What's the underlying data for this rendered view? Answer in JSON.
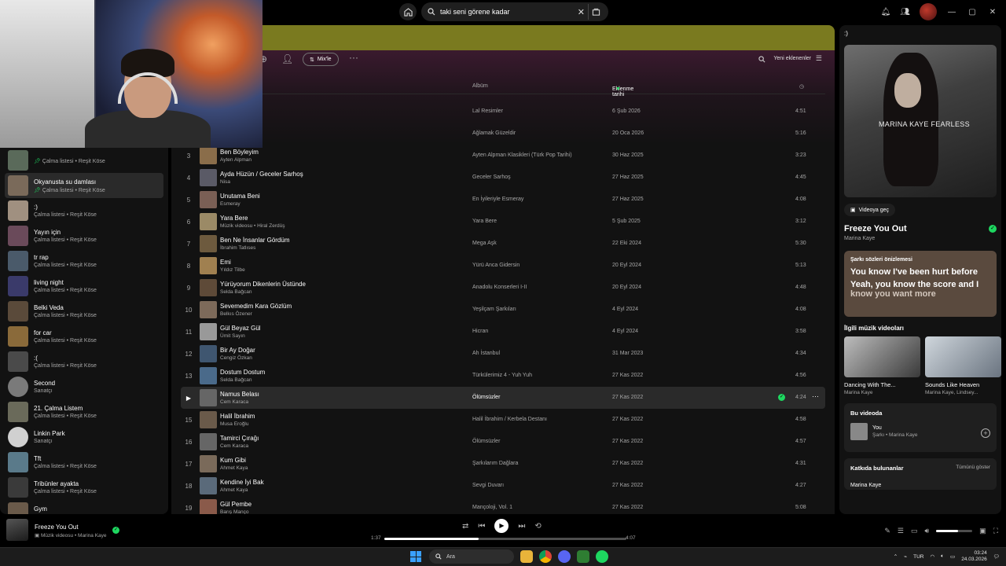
{
  "topbar": {
    "search_value": "taki seni görene kadar",
    "controls": [
      "—",
      "▢",
      "✕"
    ]
  },
  "banner_color": "#7a7a1f",
  "accent_color": "#1ed760",
  "action_bar": {
    "mix_label": "Mix'le",
    "sort_label": "Yeni eklenenler"
  },
  "columns": {
    "album": "Albüm",
    "date": "Eklenme tarihi"
  },
  "tracks": [
    {
      "num": "",
      "title": "",
      "artist": "",
      "album": "Lal Resimler",
      "date": "6 Şub 2026",
      "duration": "4:51",
      "color": "#6b4e3c"
    },
    {
      "num": "",
      "title": "",
      "artist": "",
      "album": "Ağlamak Güzeldir",
      "date": "20 Oca 2026",
      "duration": "5:16",
      "color": "#444"
    },
    {
      "num": "3",
      "title": "Ben Böyleyim",
      "artist": "Ayten Alpman",
      "album": "Ayten Alpman Klasikleri (Türk Pop Tarihi)",
      "date": "30 Haz 2025",
      "duration": "3:23",
      "color": "#8a6d4a"
    },
    {
      "num": "4",
      "title": "Ayda Hüzün / Geceler Sarhoş",
      "artist": "Nisa",
      "album": "Geceler Sarhoş",
      "date": "27 Haz 2025",
      "duration": "4:45",
      "color": "#5a5a66"
    },
    {
      "num": "5",
      "title": "Unutama Beni",
      "artist": "Esmeray",
      "album": "En İyileriyle Esmeray",
      "date": "27 Haz 2025",
      "duration": "4:08",
      "color": "#7a5f55"
    },
    {
      "num": "6",
      "title": "Yara Bere",
      "artist": "Müzik videosu • Hiral Zerdüş",
      "album": "Yara Bere",
      "date": "5 Şub 2025",
      "duration": "3:12",
      "color": "#9b8a66"
    },
    {
      "num": "7",
      "title": "Ben Ne İnsanlar Gördüm",
      "artist": "İbrahim Tatlıses",
      "album": "Mega Aşk",
      "date": "22 Eki 2024",
      "duration": "5:30",
      "color": "#6d5a3e"
    },
    {
      "num": "8",
      "title": "Emi",
      "artist": "Yıldız Tilbe",
      "album": "Yürü Anca Gidersin",
      "date": "20 Eyl 2024",
      "duration": "5:13",
      "color": "#a08050"
    },
    {
      "num": "9",
      "title": "Yürüyorum Dikenlerin Üstünde",
      "artist": "Selda Bağcan",
      "album": "Anadolu Konserleri I-II",
      "date": "20 Eyl 2024",
      "duration": "4:48",
      "color": "#5e4a38"
    },
    {
      "num": "10",
      "title": "Sevemedim Kara Gözlüm",
      "artist": "Belkıs Özener",
      "album": "Yeşilçam Şarkıları",
      "date": "4 Eyl 2024",
      "duration": "4:08",
      "color": "#7d6a5a"
    },
    {
      "num": "11",
      "title": "Gül Beyaz Gül",
      "artist": "Ümit Sayın",
      "album": "Hicran",
      "date": "4 Eyl 2024",
      "duration": "3:58",
      "color": "#999"
    },
    {
      "num": "12",
      "title": "Bir Ay Doğar",
      "artist": "Cengiz Özkan",
      "album": "Ah İstanbul",
      "date": "31 Mar 2023",
      "duration": "4:34",
      "color": "#3f5670"
    },
    {
      "num": "13",
      "title": "Dostum Dostum",
      "artist": "Selda Bağcan",
      "album": "Türkülerimiz 4 - Yuh Yuh",
      "date": "27 Kas 2022",
      "duration": "4:56",
      "color": "#4a6a8a"
    },
    {
      "num": "",
      "title": "Namus Belası",
      "artist": "Cem Karaca",
      "album": "Ölümsüzler",
      "date": "27 Kas 2022",
      "duration": "4:24",
      "color": "#666",
      "playing": true
    },
    {
      "num": "15",
      "title": "Halil İbrahim",
      "artist": "Musa Eroğlu",
      "album": "Halil İbrahim / Kerbela Destanı",
      "date": "27 Kas 2022",
      "duration": "4:58",
      "color": "#6a5a4a"
    },
    {
      "num": "16",
      "title": "Tamirci Çırağı",
      "artist": "Cem Karaca",
      "album": "Ölümsüzler",
      "date": "27 Kas 2022",
      "duration": "4:57",
      "color": "#666"
    },
    {
      "num": "17",
      "title": "Kum Gibi",
      "artist": "Ahmet Kaya",
      "album": "Şarkılarım Dağlara",
      "date": "27 Kas 2022",
      "duration": "4:31",
      "color": "#7a6a5a"
    },
    {
      "num": "18",
      "title": "Kendine İyi Bak",
      "artist": "Ahmet Kaya",
      "album": "Sevgi Duvarı",
      "date": "27 Kas 2022",
      "duration": "4:27",
      "color": "#5a6a7a"
    },
    {
      "num": "19",
      "title": "Gül Pembe",
      "artist": "Barış Manço",
      "album": "Mançoloji, Vol. 1",
      "date": "27 Kas 2022",
      "duration": "5:08",
      "color": "#8a5a4a"
    }
  ],
  "sidebar": [
    {
      "title": "",
      "sub": "Çalma listesi • Reşit Köse",
      "pinned": true,
      "color": "#5a6a5a"
    },
    {
      "title": "Okyanusta su damlası",
      "sub": "Çalma listesi • Reşit Köse",
      "pinned": true,
      "color": "#7a6a5a",
      "active": true
    },
    {
      "title": ":)",
      "sub": "Çalma listesi • Reşit Köse",
      "color": "#a09080"
    },
    {
      "title": "Yayın için",
      "sub": "Çalma listesi • Reşit Köse",
      "color": "#6a4a5a"
    },
    {
      "title": "tr rap",
      "sub": "Çalma listesi • Reşit Köse",
      "color": "#4a5a6a"
    },
    {
      "title": "living night",
      "sub": "Çalma listesi • Reşit Köse",
      "color": "#3a3a6a"
    },
    {
      "title": "Belki Veda",
      "sub": "Çalma listesi • Reşit Köse",
      "color": "#5a4a3a"
    },
    {
      "title": "for car",
      "sub": "Çalma listesi • Reşit Köse",
      "color": "#8a6a3a"
    },
    {
      "title": ":(",
      "sub": "Çalma listesi • Reşit Köse",
      "color": "#4a4a4a"
    },
    {
      "title": "Second",
      "sub": "Sanatçı",
      "round": true,
      "color": "#7a7a7a"
    },
    {
      "title": "21. Çalma Listem",
      "sub": "Çalma listesi • Reşit Köse",
      "color": "#6a6a5a"
    },
    {
      "title": "Linkin Park",
      "sub": "Sanatçı",
      "round": true,
      "color": "#d0d0d0"
    },
    {
      "title": "Tft",
      "sub": "Çalma listesi • Reşit Köse",
      "color": "#5a7a8a"
    },
    {
      "title": "Tribünler ayakta",
      "sub": "Çalma listesi • Reşit Köse",
      "color": "#3a3a3a"
    },
    {
      "title": "Gym",
      "sub": "Çalma listesi • Reşit Köse",
      "color": "#6a5a4a"
    }
  ],
  "right_panel": {
    "title": ":)",
    "cover_text": "MARINA KAYE FEARLESS",
    "video_btn": "Videoya geç",
    "track_title": "Freeze You Out",
    "artist": "Marina Kaye",
    "lyrics_heading": "Şarkı sözleri önizlemesi",
    "lyrics": [
      "You know I've been hurt before",
      "Yeah, you know the score and I",
      "know you want more"
    ],
    "related_heading": "İlgili müzik videoları",
    "related": [
      {
        "title": "Dancing With The...",
        "sub": "Marina Kaye",
        "color": "#9a9a9a"
      },
      {
        "title": "Sounds Like Heaven",
        "sub": "Marina Kaye, Lindsey...",
        "color": "#aab3bb"
      }
    ],
    "in_video_heading": "Bu videoda",
    "in_video_title": "You",
    "in_video_sub": "Şarkı • Marina Kaye",
    "credits_heading": "Katkıda bulunanlar",
    "credits_all": "Tümünü göster",
    "credits_name": "Marina Kaye"
  },
  "player": {
    "title": "Freeze You Out",
    "sub": "Müzik videosu • Marina Kaye",
    "elapsed": "1:37",
    "total": "4:07",
    "progress": 0.39,
    "volume": 0.6
  },
  "taskbar": {
    "search_placeholder": "Ara",
    "lang": "TUR",
    "time": "03:24",
    "date": "24.03.2026"
  }
}
